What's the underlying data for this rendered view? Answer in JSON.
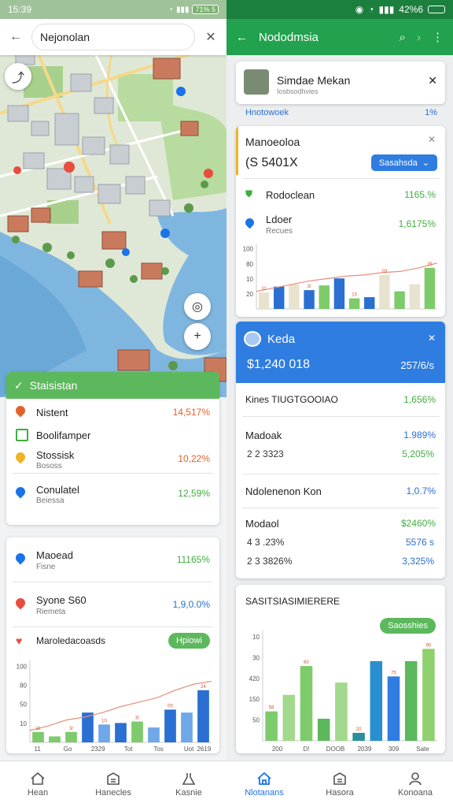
{
  "left": {
    "status": {
      "time": "15:39",
      "battery": "71% 5"
    },
    "search": {
      "value": "Nejonolan"
    },
    "stats_card": {
      "title": "Staisistan",
      "rows": [
        {
          "label": "Nistent",
          "value": "14,517%",
          "color": "#e2622c",
          "icon": "location-pin-icon"
        },
        {
          "label": "Boolifamper",
          "value": "",
          "color": "#3fae3f",
          "icon": "chart-icon"
        },
        {
          "label": "Stossisk",
          "sub": "Bososs",
          "value": "10,22%",
          "color": "#e2622c",
          "icon": "location-pin-icon"
        },
        {
          "label": "Conulatel",
          "sub": "Beiessa",
          "value": "12,59%",
          "color": "#3fae3f",
          "icon": "location-pin-icon"
        }
      ]
    },
    "places_card": {
      "rows": [
        {
          "label": "Maoead",
          "sub": "Fisne",
          "value": "11165%",
          "color": "#3fae3f",
          "icon": "location-pin-icon"
        },
        {
          "label": "Syone S60",
          "sub": "Riemeta",
          "value": "1,9,0.0%",
          "color": "#2a6fd1",
          "icon": "location-pin-icon"
        }
      ],
      "chart_title": "Maroledacoasds",
      "chart_button": "Hpiowi"
    }
  },
  "right": {
    "status": {
      "battery": "42%6"
    },
    "appbar": {
      "title": "Nododmsia"
    },
    "profile_card": {
      "name": "Simdae Mekan",
      "sub": "Iosbsodhvies"
    },
    "summary_line": {
      "label": "Hnotowoek",
      "value": "1%"
    },
    "metrics_card": {
      "title": "Manoeoloa",
      "amount": "(S 5401X",
      "button": "Sasahsda",
      "rows": [
        {
          "label": "Rodoclean",
          "value": "1165.%",
          "icon": "shield-icon"
        },
        {
          "label": "Ldoer",
          "sub": "Recues",
          "value": "1,6175%",
          "icon": "location-pin-icon"
        }
      ],
      "chart_title": ""
    },
    "blue_card": {
      "title": "Keda",
      "amount": "$1,240 018",
      "amount_right": "257/6/s",
      "rows": [
        {
          "label": "Kines TIUGTGOOIAO",
          "value": "1,656%",
          "color": "#3fae3f"
        },
        {
          "label": "Madoak",
          "value": "1.989%",
          "color": "#2a6fd1",
          "sub_label": "2 2  3323",
          "sub_value": "5,205%",
          "sub_color": "#3fae3f"
        },
        {
          "label": "Ndolenenon Kon",
          "value": "1,0.7%",
          "color": "#2a6fd1"
        },
        {
          "label": "Modaol",
          "value": "$2460%",
          "color": "#3fae3f",
          "sub_label": "4 3 .23%",
          "sub_value": "5576 s",
          "sub_color": "#2a6fd1",
          "sub2_label": "2 3 3826%",
          "sub2_value": "3,325%",
          "sub2_color": "#2a6fd1"
        }
      ]
    },
    "bottom_card": {
      "title": "SASITSIASIMIERERE",
      "button": "Saosshies"
    }
  },
  "bottom_nav": [
    {
      "label": "Hean",
      "icon": "home-icon",
      "active": false
    },
    {
      "label": "Hanecles",
      "icon": "building-icon",
      "active": false
    },
    {
      "label": "Kasnie",
      "icon": "flask-icon",
      "active": false
    },
    {
      "label": "Nlotanans",
      "icon": "home-icon",
      "active": true
    },
    {
      "label": "Hasora",
      "icon": "building-icon",
      "active": false
    },
    {
      "label": "Konoana",
      "icon": "person-icon",
      "active": false
    }
  ],
  "chart_data": [
    {
      "type": "bar",
      "categories": [
        "11",
        "",
        "Go",
        "",
        "2329",
        "",
        "Tot",
        "",
        "Tos",
        "",
        "Uot",
        "2619"
      ],
      "ylim": [
        0,
        110
      ],
      "yticks": [
        10,
        50,
        80,
        100
      ],
      "series": [
        {
          "values": [
            14,
            8,
            14,
            40,
            24,
            26,
            28,
            20,
            44,
            40,
            70
          ]
        }
      ],
      "line": {
        "values": [
          16,
          22,
          30,
          34,
          40,
          48,
          54,
          60,
          70,
          78,
          82
        ]
      },
      "labels": [
        "11",
        "3/",
        "10",
        "3/",
        "00",
        "24"
      ]
    },
    {
      "type": "bar",
      "ylim": [
        0,
        110
      ],
      "yticks": [
        20,
        10,
        80,
        100
      ],
      "series": [
        {
          "values": [
            28,
            38,
            42,
            32,
            40,
            52,
            18,
            20,
            58,
            30,
            42,
            70
          ]
        }
      ],
      "line": {
        "values": [
          30,
          36,
          42,
          48,
          52,
          56,
          58,
          62,
          64,
          70,
          78
        ]
      },
      "labels": [
        "11",
        "3/",
        "10",
        "03",
        "25"
      ]
    },
    {
      "type": "bar",
      "categories": [
        "200",
        "D!",
        "DOOB",
        "2039",
        "309",
        "Sate"
      ],
      "yticks": [
        50,
        150,
        420,
        30,
        10
      ],
      "ylim": [
        0,
        180
      ],
      "series": [
        {
          "values": [
            48,
            75,
            122,
            36,
            95,
            13,
            130,
            105,
            130,
            150
          ]
        }
      ],
      "labels": [
        "58",
        "60",
        "20",
        "75",
        "90"
      ]
    }
  ]
}
